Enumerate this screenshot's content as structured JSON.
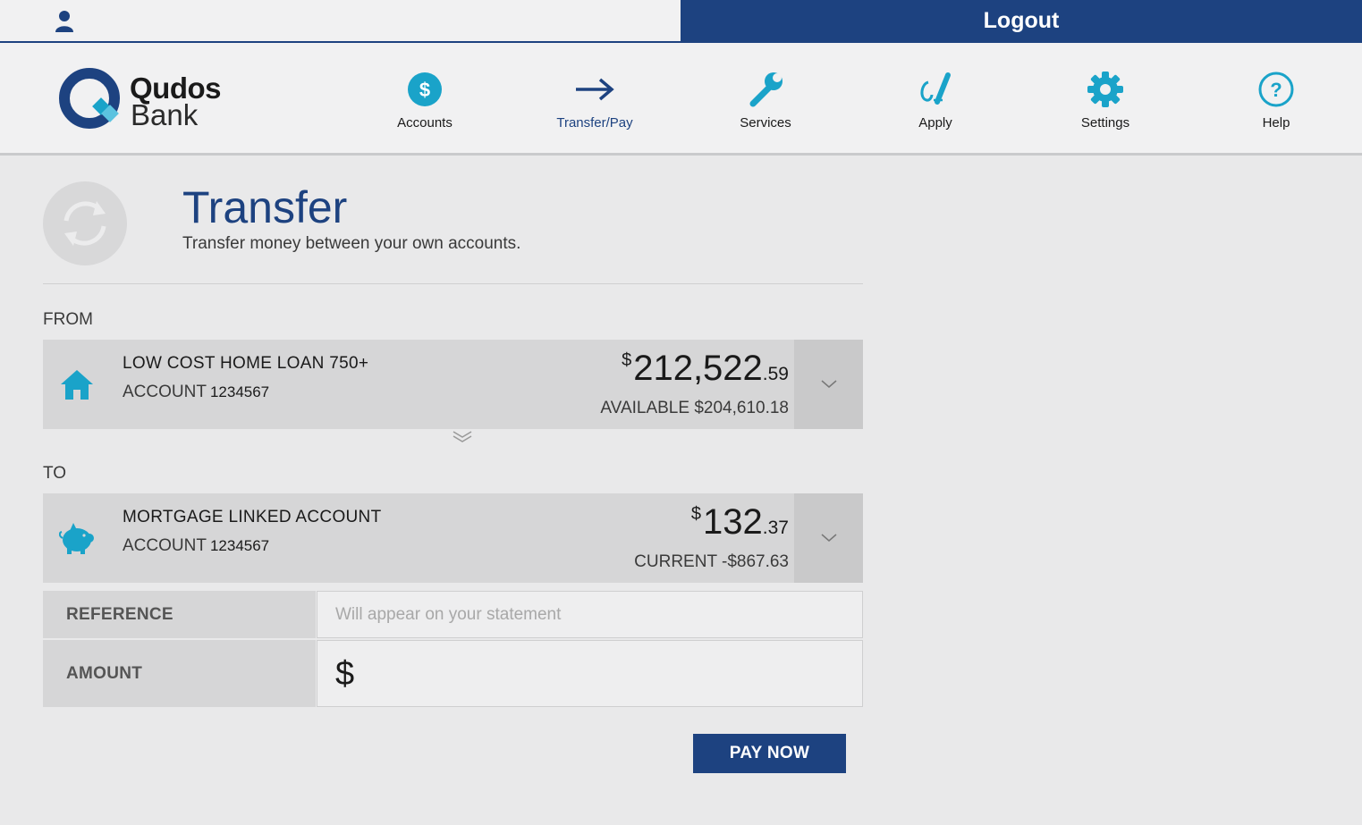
{
  "topbar": {
    "logout_label": "Logout"
  },
  "brand": {
    "line1": "Qudos",
    "line2": "Bank"
  },
  "nav": {
    "items": [
      {
        "label": "Accounts",
        "icon": "dollar-circle-icon"
      },
      {
        "label": "Transfer/Pay",
        "icon": "arrow-right-icon",
        "active": true
      },
      {
        "label": "Services",
        "icon": "wrench-icon"
      },
      {
        "label": "Apply",
        "icon": "pen-signature-icon"
      },
      {
        "label": "Settings",
        "icon": "gear-icon"
      },
      {
        "label": "Help",
        "icon": "question-circle-icon"
      }
    ]
  },
  "page": {
    "title": "Transfer",
    "subtitle": "Transfer money between your own accounts."
  },
  "from": {
    "section_label": "FROM",
    "account": {
      "name": "LOW COST HOME LOAN 750+",
      "account_label": "ACCOUNT",
      "account_number": "1234567",
      "currency_symbol": "$",
      "balance_whole": "212,522",
      "balance_cents": ".59",
      "sub_text": "AVAILABLE $204,610.18",
      "icon": "house-icon"
    }
  },
  "to": {
    "section_label": "TO",
    "account": {
      "name": "MORTGAGE LINKED ACCOUNT",
      "account_label": "ACCOUNT",
      "account_number": "1234567",
      "currency_symbol": "$",
      "balance_whole": "132",
      "balance_cents": ".37",
      "sub_text": "CURRENT -$867.63",
      "icon": "piggy-bank-icon"
    }
  },
  "form": {
    "reference_label": "REFERENCE",
    "reference_placeholder": "Will appear on your statement",
    "reference_value": "",
    "amount_label": "AMOUNT",
    "amount_symbol": "$",
    "amount_value": ""
  },
  "actions": {
    "pay_now_label": "PAY NOW"
  },
  "colors": {
    "brand_navy": "#1d4280",
    "accent_teal": "#1aa3c9"
  }
}
